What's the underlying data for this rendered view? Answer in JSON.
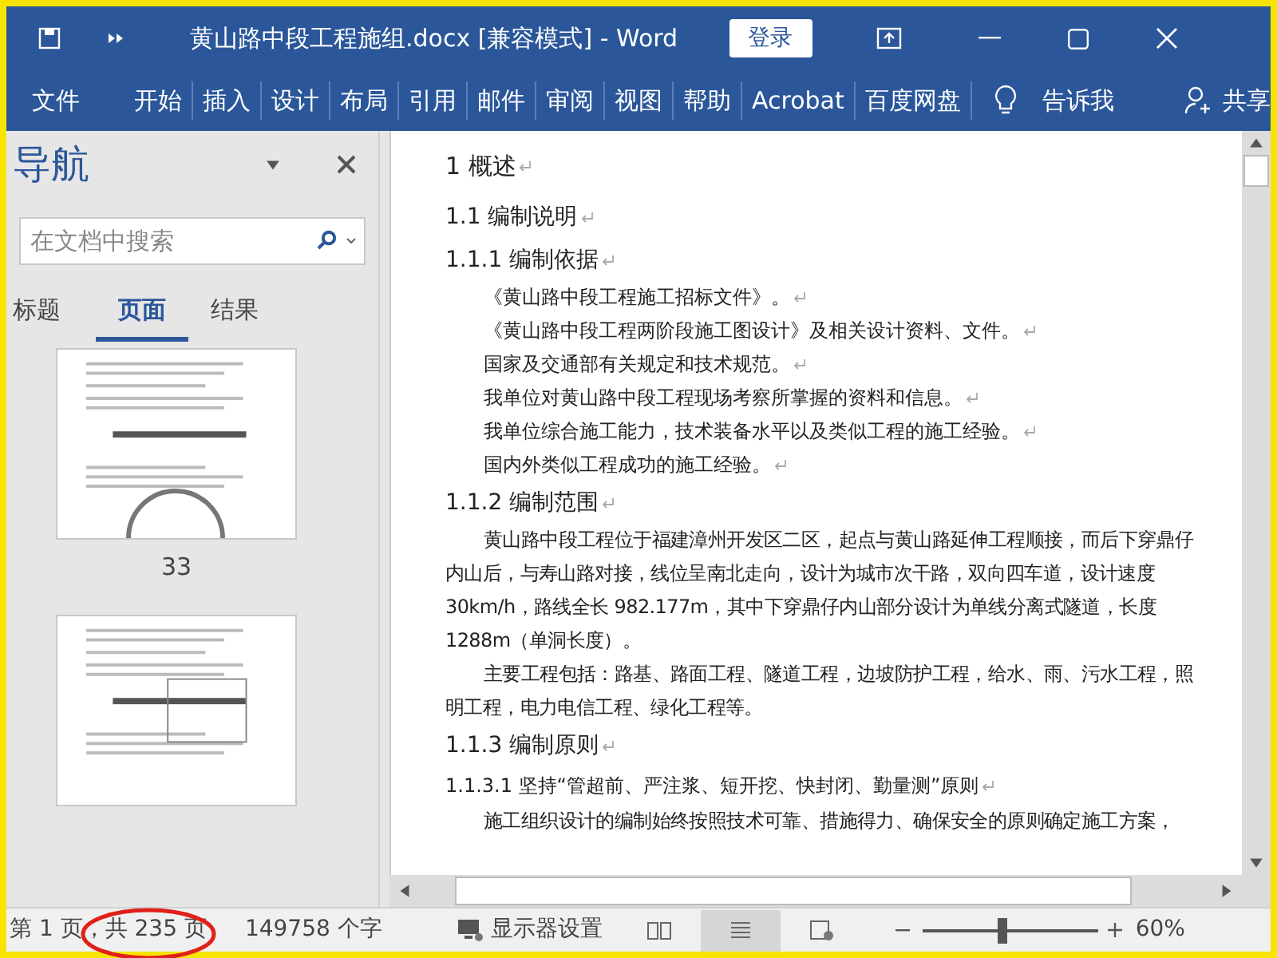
{
  "window": {
    "title": "黄山路中段工程施组.docx [兼容模式]  -  Word",
    "login": "登录"
  },
  "ribbon": {
    "tabs": [
      {
        "label": "文件",
        "selected": false
      },
      {
        "label": "开始",
        "selected": false
      },
      {
        "label": "插入",
        "selected": false
      },
      {
        "label": "设计",
        "selected": false
      },
      {
        "label": "布局",
        "selected": false
      },
      {
        "label": "引用",
        "selected": false
      },
      {
        "label": "邮件",
        "selected": false
      },
      {
        "label": "审阅",
        "selected": false
      },
      {
        "label": "视图",
        "selected": false
      },
      {
        "label": "帮助",
        "selected": false
      },
      {
        "label": "Acrobat",
        "selected": false
      },
      {
        "label": "百度网盘",
        "selected": false
      }
    ],
    "tell_me": "告诉我",
    "share": "共享"
  },
  "navigation": {
    "title": "导航",
    "search": {
      "placeholder": "在文档中搜索"
    },
    "tabs": [
      {
        "label": "标题",
        "selected": false
      },
      {
        "label": "页面",
        "selected": true
      },
      {
        "label": "结果",
        "selected": false
      }
    ],
    "pages": [
      {
        "kind": "arch",
        "number": "33"
      },
      {
        "kind": "diagram"
      }
    ]
  },
  "document": {
    "paragraphs": [
      {
        "kind": "h1",
        "text": "1  概述"
      },
      {
        "kind": "h2",
        "text": "1.1  编制说明"
      },
      {
        "kind": "h3",
        "text": "1.1.1  编制依据"
      },
      {
        "kind": "item",
        "text": "《黄山路中段工程施工招标文件》。"
      },
      {
        "kind": "item",
        "text": "《黄山路中段工程两阶段施工图设计》及相关设计资料、文件。"
      },
      {
        "kind": "item",
        "text": "国家及交通部有关规定和技术规范。"
      },
      {
        "kind": "item",
        "text": "我单位对黄山路中段工程现场考察所掌握的资料和信息。"
      },
      {
        "kind": "item",
        "text": "我单位综合施工能力，技术装备水平以及类似工程的施工经验。"
      },
      {
        "kind": "item",
        "text": "国内外类似工程成功的施工经验。"
      },
      {
        "kind": "h3",
        "text": "1.1.2  编制范围"
      },
      {
        "kind": "body",
        "text": "黄山路中段工程位于福建漳州开发区二区，起点与黄山路延伸工程顺接，而后下穿鼎仔内山后，与寿山路对接，线位呈南北走向，设计为城市次干路，双向四车道，设计速度 30km/h，路线全长 982.177m，其中下穿鼎仔内山部分设计为单线分离式隧道，长度 1288m（单洞长度）。"
      },
      {
        "kind": "body",
        "text": "主要工程包括：路基、路面工程、隧道工程，边坡防护工程，给水、雨、污水工程，照明工程，电力电信工程、绿化工程等。"
      },
      {
        "kind": "h3",
        "text": "1.1.3  编制原则"
      },
      {
        "kind": "h4",
        "text": "1.1.3.1  坚持“管超前、严注浆、短开挖、快封闭、勤量测”原则"
      },
      {
        "kind": "body",
        "text": "施工组织设计的编制始终按照技术可靠、措施得力、确保安全的原则确定施工方案，"
      }
    ]
  },
  "status_bar": {
    "page": "第 1 页，共 235 页",
    "words": "149758 个字",
    "display": "显示器设置",
    "zoom": {
      "level": 0.45,
      "reading": "60%"
    }
  }
}
